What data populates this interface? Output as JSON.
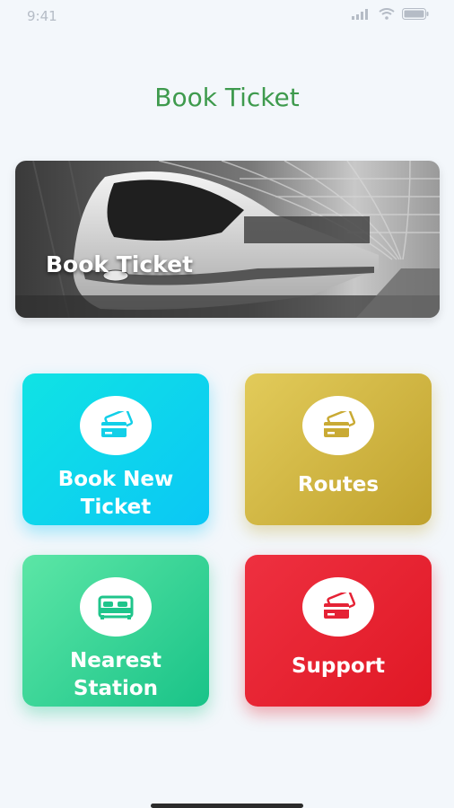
{
  "status_bar": {
    "time": "9:41",
    "icons": [
      "signal-icon",
      "wifi-icon",
      "battery-icon"
    ]
  },
  "header": {
    "title": "Book Ticket",
    "title_color": "#3e9a4d"
  },
  "banner": {
    "label": "Book Ticket",
    "image": "metro-train-photo"
  },
  "tiles": [
    {
      "label": "Book New\nTicket",
      "icon": "ticket-card-icon",
      "color": "#0bc7f5"
    },
    {
      "label": "Routes",
      "icon": "ticket-card-icon",
      "color": "#c0a22e"
    },
    {
      "label": "Nearest\nStation",
      "icon": "bed-icon",
      "color": "#19c388"
    },
    {
      "label": "Support",
      "icon": "ticket-card-icon",
      "color": "#e01825"
    }
  ]
}
